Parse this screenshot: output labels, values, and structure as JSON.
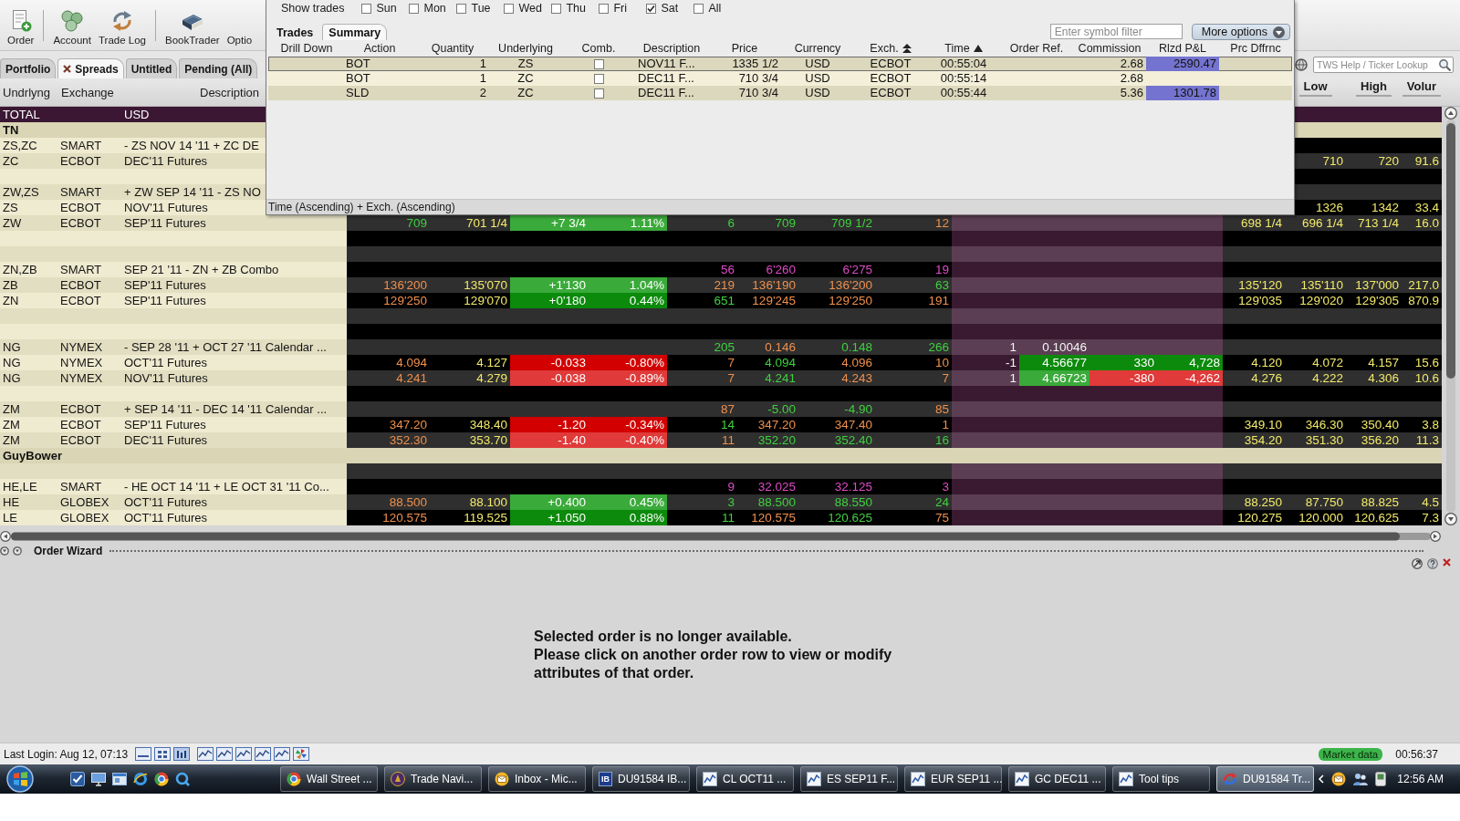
{
  "toolbar": {
    "groups": [
      [
        {
          "label": "Order"
        }
      ],
      [
        {
          "label": "Account"
        },
        {
          "label": "Trade Log"
        }
      ],
      [
        {
          "label": "BookTrader"
        },
        {
          "label": "Optio"
        }
      ]
    ]
  },
  "tabs": [
    {
      "label": "Portfolio",
      "selected": false,
      "closable": false
    },
    {
      "label": "Spreads",
      "selected": true,
      "closable": true
    },
    {
      "label": "Untitled",
      "selected": false,
      "closable": false
    },
    {
      "label": "Pending (All)",
      "selected": false,
      "closable": false
    }
  ],
  "ticker_lookup": {
    "placeholder": "TWS Help / Ticker Lookup"
  },
  "grid": {
    "columns": {
      "underlying": "Undrlyng",
      "exchange": "Exchange",
      "description": "Description",
      "low": "Low",
      "high": "High",
      "column_19": "Volur"
    },
    "rows": [
      {
        "kind": "total",
        "underlying": "TOTAL",
        "description": "USD"
      },
      {
        "kind": "group",
        "underlying": "TN"
      },
      {
        "kind": "instrument",
        "underlying": "ZS,ZC",
        "exchange": "SMART",
        "description": "- ZS NOV 14 '11 + ZC DE"
      },
      {
        "kind": "instrument",
        "underlying": "ZC",
        "exchange": "ECBOT",
        "description": "DEC'11 Futures",
        "cells": {
          "low": {
            "text": "710",
            "kind": "quote"
          },
          "high": {
            "text": "720",
            "kind": "quote"
          },
          "column_19": {
            "text": "91.6",
            "kind": "quote"
          }
        }
      },
      {
        "kind": "spacer"
      },
      {
        "kind": "instrument",
        "underlying": "ZW,ZS",
        "exchange": "SMART",
        "description": "+ ZW SEP 14 '11 - ZS NO"
      },
      {
        "kind": "instrument",
        "underlying": "ZS",
        "exchange": "ECBOT",
        "description": "NOV'11 Futures",
        "cells": {
          "low": {
            "text": "1326",
            "kind": "quote"
          },
          "high": {
            "text": "1342",
            "kind": "quote"
          },
          "column_19": {
            "text": "33.4",
            "kind": "quote"
          }
        }
      },
      {
        "kind": "instrument",
        "underlying": "ZW",
        "exchange": "ECBOT",
        "description": "SEP'11 Futures",
        "cells": {
          "column_4": {
            "text": "709",
            "kind": "up"
          },
          "column_5": {
            "text": "701 1/4",
            "kind": "quote"
          },
          "column_6": {
            "text": "+7 3/4",
            "kind": "gain"
          },
          "column_7": {
            "text": "1.11%",
            "kind": "gain"
          },
          "column_8": {
            "text": "6",
            "kind": "up"
          },
          "column_9": {
            "text": "709",
            "kind": "up"
          },
          "column_10": {
            "text": "709 1/2",
            "kind": "up"
          },
          "column_11": {
            "text": "12",
            "kind": "down"
          },
          "column_16": {
            "text": "698 1/4",
            "kind": "quote"
          },
          "low": {
            "text": "696 1/4",
            "kind": "quote"
          },
          "high": {
            "text": "713 1/4",
            "kind": "quote"
          },
          "column_19": {
            "text": "16.0",
            "kind": "quote"
          }
        }
      },
      {
        "kind": "spacer"
      },
      {
        "kind": "spacer"
      },
      {
        "kind": "instrument",
        "underlying": "ZN,ZB",
        "exchange": "SMART",
        "description": "SEP 21 '11 - ZN + ZB Combo",
        "cells": {
          "column_8": {
            "text": "56",
            "kind": "flagged"
          },
          "column_9": {
            "text": "6'260",
            "kind": "flagged"
          },
          "column_10": {
            "text": "6'275",
            "kind": "flagged"
          },
          "column_11": {
            "text": "19",
            "kind": "flagged"
          }
        }
      },
      {
        "kind": "instrument",
        "underlying": "ZB",
        "exchange": "ECBOT",
        "description": "SEP'11 Futures",
        "cells": {
          "column_4": {
            "text": "136'200",
            "kind": "down"
          },
          "column_5": {
            "text": "135'070",
            "kind": "quote"
          },
          "column_6": {
            "text": "+1'130",
            "kind": "gain"
          },
          "column_7": {
            "text": "1.04%",
            "kind": "gain"
          },
          "column_8": {
            "text": "219",
            "kind": "down"
          },
          "column_9": {
            "text": "136'190",
            "kind": "down"
          },
          "column_10": {
            "text": "136'200",
            "kind": "down"
          },
          "column_11": {
            "text": "63",
            "kind": "up"
          },
          "column_16": {
            "text": "135'120",
            "kind": "quote"
          },
          "low": {
            "text": "135'110",
            "kind": "quote"
          },
          "high": {
            "text": "137'000",
            "kind": "quote"
          },
          "column_19": {
            "text": "217.0",
            "kind": "quote"
          }
        }
      },
      {
        "kind": "instrument",
        "underlying": "ZN",
        "exchange": "ECBOT",
        "description": "SEP'11 Futures",
        "cells": {
          "column_4": {
            "text": "129'250",
            "kind": "down"
          },
          "column_5": {
            "text": "129'070",
            "kind": "quote"
          },
          "column_6": {
            "text": "+0'180",
            "kind": "gain"
          },
          "column_7": {
            "text": "0.44%",
            "kind": "gain"
          },
          "column_8": {
            "text": "651",
            "kind": "up"
          },
          "column_9": {
            "text": "129'245",
            "kind": "down"
          },
          "column_10": {
            "text": "129'250",
            "kind": "down"
          },
          "column_11": {
            "text": "191",
            "kind": "down"
          },
          "column_16": {
            "text": "129'035",
            "kind": "quote"
          },
          "low": {
            "text": "129'020",
            "kind": "quote"
          },
          "high": {
            "text": "129'305",
            "kind": "quote"
          },
          "column_19": {
            "text": "870.9",
            "kind": "quote"
          }
        }
      },
      {
        "kind": "spacer"
      },
      {
        "kind": "spacer"
      },
      {
        "kind": "instrument",
        "underlying": "NG",
        "exchange": "NYMEX",
        "description": "- SEP 28 '11 + OCT 27 '11 Calendar ...",
        "cells": {
          "column_8": {
            "text": "205",
            "kind": "up"
          },
          "column_9": {
            "text": "0.146",
            "kind": "down"
          },
          "column_10": {
            "text": "0.148",
            "kind": "up"
          },
          "column_11": {
            "text": "266",
            "kind": "up"
          },
          "column_12": {
            "text": "1",
            "kind": "position"
          },
          "column_13": {
            "text": "0.10046",
            "kind": "position"
          }
        }
      },
      {
        "kind": "instrument",
        "underlying": "NG",
        "exchange": "NYMEX",
        "description": "OCT'11 Futures",
        "cells": {
          "column_4": {
            "text": "4.094",
            "kind": "down"
          },
          "column_5": {
            "text": "4.127",
            "kind": "quote"
          },
          "column_6": {
            "text": "-0.033",
            "kind": "loss"
          },
          "column_7": {
            "text": "-0.80%",
            "kind": "loss"
          },
          "column_8": {
            "text": "7",
            "kind": "down"
          },
          "column_9": {
            "text": "4.094",
            "kind": "up"
          },
          "column_10": {
            "text": "4.096",
            "kind": "down"
          },
          "column_11": {
            "text": "10",
            "kind": "down"
          },
          "column_12": {
            "text": "-1",
            "kind": "position"
          },
          "column_13": {
            "text": "4.56677",
            "kind": "gain"
          },
          "column_14": {
            "text": "330",
            "kind": "gain"
          },
          "column_15": {
            "text": "4,728",
            "kind": "gain"
          },
          "column_16": {
            "text": "4.120",
            "kind": "quote"
          },
          "low": {
            "text": "4.072",
            "kind": "quote"
          },
          "high": {
            "text": "4.157",
            "kind": "quote"
          },
          "column_19": {
            "text": "15.6",
            "kind": "quote"
          }
        }
      },
      {
        "kind": "instrument",
        "underlying": "NG",
        "exchange": "NYMEX",
        "description": "NOV'11 Futures",
        "cells": {
          "column_4": {
            "text": "4.241",
            "kind": "down"
          },
          "column_5": {
            "text": "4.279",
            "kind": "quote"
          },
          "column_6": {
            "text": "-0.038",
            "kind": "loss"
          },
          "column_7": {
            "text": "-0.89%",
            "kind": "loss"
          },
          "column_8": {
            "text": "7",
            "kind": "down"
          },
          "column_9": {
            "text": "4.241",
            "kind": "up"
          },
          "column_10": {
            "text": "4.243",
            "kind": "down"
          },
          "column_11": {
            "text": "7",
            "kind": "down"
          },
          "column_12": {
            "text": "1",
            "kind": "position"
          },
          "column_13": {
            "text": "4.66723",
            "kind": "gain"
          },
          "column_14": {
            "text": "-380",
            "kind": "loss"
          },
          "column_15": {
            "text": "-4,262",
            "kind": "loss"
          },
          "column_16": {
            "text": "4.276",
            "kind": "quote"
          },
          "low": {
            "text": "4.222",
            "kind": "quote"
          },
          "high": {
            "text": "4.306",
            "kind": "quote"
          },
          "column_19": {
            "text": "10.6",
            "kind": "quote"
          }
        }
      },
      {
        "kind": "spacer"
      },
      {
        "kind": "instrument",
        "underlying": "ZM",
        "exchange": "ECBOT",
        "description": "+ SEP 14 '11 - DEC 14 '11 Calendar ...",
        "cells": {
          "column_8": {
            "text": "87",
            "kind": "down"
          },
          "column_9": {
            "text": "-5.00",
            "kind": "up"
          },
          "column_10": {
            "text": "-4.90",
            "kind": "up"
          },
          "column_11": {
            "text": "85",
            "kind": "down"
          }
        }
      },
      {
        "kind": "instrument",
        "underlying": "ZM",
        "exchange": "ECBOT",
        "description": "SEP'11 Futures",
        "cells": {
          "column_4": {
            "text": "347.20",
            "kind": "down"
          },
          "column_5": {
            "text": "348.40",
            "kind": "quote"
          },
          "column_6": {
            "text": "-1.20",
            "kind": "loss"
          },
          "column_7": {
            "text": "-0.34%",
            "kind": "loss"
          },
          "column_8": {
            "text": "14",
            "kind": "up"
          },
          "column_9": {
            "text": "347.20",
            "kind": "down"
          },
          "column_10": {
            "text": "347.40",
            "kind": "down"
          },
          "column_11": {
            "text": "1",
            "kind": "down"
          },
          "column_16": {
            "text": "349.10",
            "kind": "quote"
          },
          "low": {
            "text": "346.30",
            "kind": "quote"
          },
          "high": {
            "text": "350.40",
            "kind": "quote"
          },
          "column_19": {
            "text": "3.8",
            "kind": "quote"
          }
        }
      },
      {
        "kind": "instrument",
        "underlying": "ZM",
        "exchange": "ECBOT",
        "description": "DEC'11 Futures",
        "cells": {
          "column_4": {
            "text": "352.30",
            "kind": "down"
          },
          "column_5": {
            "text": "353.70",
            "kind": "quote"
          },
          "column_6": {
            "text": "-1.40",
            "kind": "loss"
          },
          "column_7": {
            "text": "-0.40%",
            "kind": "loss"
          },
          "column_8": {
            "text": "11",
            "kind": "down"
          },
          "column_9": {
            "text": "352.20",
            "kind": "up"
          },
          "column_10": {
            "text": "352.40",
            "kind": "up"
          },
          "column_11": {
            "text": "16",
            "kind": "up"
          },
          "column_16": {
            "text": "354.20",
            "kind": "quote"
          },
          "low": {
            "text": "351.30",
            "kind": "quote"
          },
          "high": {
            "text": "356.20",
            "kind": "quote"
          },
          "column_19": {
            "text": "11.3",
            "kind": "quote"
          }
        }
      },
      {
        "kind": "group",
        "underlying": "GuyBower"
      },
      {
        "kind": "spacer"
      },
      {
        "kind": "instrument",
        "underlying": "HE,LE",
        "exchange": "SMART",
        "description": "- HE OCT 14 '11 + LE OCT 31 '11 Co...",
        "cells": {
          "column_8": {
            "text": "9",
            "kind": "flagged"
          },
          "column_9": {
            "text": "32.025",
            "kind": "flagged"
          },
          "column_10": {
            "text": "32.125",
            "kind": "flagged"
          },
          "column_11": {
            "text": "3",
            "kind": "flagged"
          }
        }
      },
      {
        "kind": "instrument",
        "underlying": "HE",
        "exchange": "GLOBEX",
        "description": "OCT'11 Futures",
        "cells": {
          "column_4": {
            "text": "88.500",
            "kind": "down"
          },
          "column_5": {
            "text": "88.100",
            "kind": "quote"
          },
          "column_6": {
            "text": "+0.400",
            "kind": "gain"
          },
          "column_7": {
            "text": "0.45%",
            "kind": "gain"
          },
          "column_8": {
            "text": "3",
            "kind": "up"
          },
          "column_9": {
            "text": "88.500",
            "kind": "up"
          },
          "column_10": {
            "text": "88.550",
            "kind": "up"
          },
          "column_11": {
            "text": "24",
            "kind": "up"
          },
          "column_16": {
            "text": "88.250",
            "kind": "quote"
          },
          "low": {
            "text": "87.750",
            "kind": "quote"
          },
          "high": {
            "text": "88.825",
            "kind": "quote"
          },
          "column_19": {
            "text": "4.5",
            "kind": "quote"
          }
        }
      },
      {
        "kind": "instrument",
        "underlying": "LE",
        "exchange": "GLOBEX",
        "description": "OCT'11 Futures",
        "cells": {
          "column_4": {
            "text": "120.575",
            "kind": "down"
          },
          "column_5": {
            "text": "119.525",
            "kind": "quote"
          },
          "column_6": {
            "text": "+1.050",
            "kind": "gain"
          },
          "column_7": {
            "text": "0.88%",
            "kind": "gain"
          },
          "column_8": {
            "text": "11",
            "kind": "up"
          },
          "column_9": {
            "text": "120.575",
            "kind": "down"
          },
          "column_10": {
            "text": "120.625",
            "kind": "up"
          },
          "column_11": {
            "text": "75",
            "kind": "down"
          },
          "column_16": {
            "text": "120.275",
            "kind": "quote"
          },
          "low": {
            "text": "120.000",
            "kind": "quote"
          },
          "high": {
            "text": "120.625",
            "kind": "quote"
          },
          "column_19": {
            "text": "7.3",
            "kind": "quote"
          }
        }
      }
    ]
  },
  "trades_window": {
    "show_trades_label": "Show trades",
    "days": [
      {
        "label": "Sun",
        "checked": false
      },
      {
        "label": "Mon",
        "checked": false
      },
      {
        "label": "Tue",
        "checked": false
      },
      {
        "label": "Wed",
        "checked": false
      },
      {
        "label": "Thu",
        "checked": false
      },
      {
        "label": "Fri",
        "checked": false
      },
      {
        "label": "Sat",
        "checked": true
      },
      {
        "label": "All",
        "checked": false
      }
    ],
    "tabs": [
      {
        "label": "Trades",
        "selected": false
      },
      {
        "label": "Summary",
        "selected": true
      }
    ],
    "filter": {
      "placeholder": "Enter symbol filter"
    },
    "more_options": "More options",
    "columns": [
      {
        "label": "Drill Down",
        "kind": "plain"
      },
      {
        "label": "Action",
        "kind": "plain"
      },
      {
        "label": "Quantity",
        "kind": "plain"
      },
      {
        "label": "Underlying",
        "kind": "plain"
      },
      {
        "label": "Comb.",
        "kind": "plain"
      },
      {
        "label": "Description",
        "kind": "plain"
      },
      {
        "label": "Price",
        "kind": "plain"
      },
      {
        "label": "Currency",
        "kind": "plain"
      },
      {
        "label": "Exch.",
        "kind": "secondary"
      },
      {
        "label": "Time",
        "kind": "primary"
      },
      {
        "label": "Order Ref.",
        "kind": "plain"
      },
      {
        "label": "Commission",
        "kind": "plain"
      },
      {
        "label": "Rlzd P&L",
        "kind": "plain"
      },
      {
        "label": "Prc Dffrnc",
        "kind": "plain"
      }
    ],
    "rows": [
      {
        "selected": true,
        "action": "BOT",
        "quantity": "1",
        "underlying": "ZS",
        "combo": false,
        "description": "NOV11 F...",
        "price": "1335 1/2",
        "currency": "USD",
        "exchange": "ECBOT",
        "time": "00:55:04",
        "commission": "2.68",
        "realized_pnl": "2590.47"
      },
      {
        "selected": false,
        "action": "BOT",
        "quantity": "1",
        "underlying": "ZC",
        "combo": false,
        "description": "DEC11 F...",
        "price": "710 3/4",
        "currency": "USD",
        "exchange": "ECBOT",
        "time": "00:55:14",
        "commission": "2.68"
      },
      {
        "selected": false,
        "action": "SLD",
        "quantity": "2",
        "underlying": "ZC",
        "combo": false,
        "description": "DEC11 F...",
        "price": "710 3/4",
        "currency": "USD",
        "exchange": "ECBOT",
        "time": "00:55:44",
        "commission": "5.36",
        "realized_pnl": "1301.78"
      }
    ],
    "sort_summary": "Time (Ascending)  +  Exch. (Ascending)"
  },
  "order_wizard": {
    "title": "Order Wizard",
    "message": [
      "Selected order is no longer available.",
      "Please click on another order row to view or modify attributes of that order."
    ]
  },
  "status_bar": {
    "last_login": "Last Login: Aug 12, 07:13",
    "market_data": "Market data",
    "clock": "00:56:37"
  },
  "taskbar": {
    "tasks": [
      {
        "label": "Wall Street ...",
        "selected": false
      },
      {
        "label": "Trade Navi...",
        "selected": false
      },
      {
        "label": "Inbox - Mic...",
        "selected": false
      },
      {
        "label": "DU91584 IB...",
        "selected": false,
        "badge": "IB"
      },
      {
        "label": "CL OCT11 ...",
        "selected": false
      },
      {
        "label": "ES SEP11 F...",
        "selected": false
      },
      {
        "label": "EUR SEP11 ...",
        "selected": false
      },
      {
        "label": "GC DEC11 ...",
        "selected": false
      },
      {
        "label": "Tool tips",
        "selected": false
      },
      {
        "label": "DU91584 Tr...",
        "selected": true
      }
    ],
    "clock": "12:56 AM"
  }
}
